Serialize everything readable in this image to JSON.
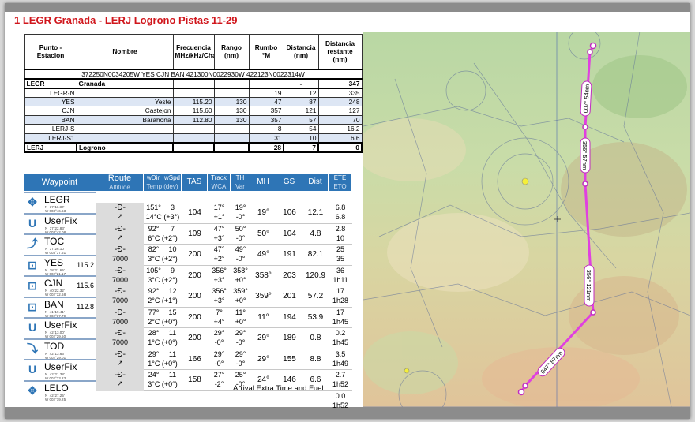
{
  "title": "1 LEGR Granada - LERJ Logrono  Pistas 11-29",
  "route_table": {
    "headers": [
      "Punto - Estacion",
      "Nombre",
      "Frecuencia MHz/kHz/Cha.",
      "Rango (nm)",
      "Rumbo °M",
      "Distancia (nm)",
      "Distancia restante (nm)"
    ],
    "code_line": "372250N0034205W  YES  CJN  BAN  421300N0022930W  422123N0022314W",
    "rows": [
      [
        "LEGR",
        "Granada",
        "",
        "",
        "",
        "-",
        "347"
      ],
      [
        "LEGR-N",
        "",
        "",
        "",
        "19",
        "12",
        "335"
      ],
      [
        "YES",
        "Yeste",
        "115.20",
        "130",
        "47",
        "87",
        "248"
      ],
      [
        "CJN",
        "Castejon",
        "115.60",
        "130",
        "357",
        "121",
        "127"
      ],
      [
        "BAN",
        "Barahona",
        "112.80",
        "130",
        "357",
        "57",
        "70"
      ],
      [
        "LERJ-S",
        "",
        "",
        "",
        "8",
        "54",
        "16.2"
      ],
      [
        "LERJ-S1",
        "",
        "",
        "",
        "31",
        "10",
        "6.6"
      ],
      [
        "LERJ",
        "Logrono",
        "",
        "",
        "28",
        "7",
        "0"
      ]
    ]
  },
  "navlog": {
    "headers": {
      "waypoint": "Waypoint",
      "route": "Route",
      "altitude": "Altitude",
      "wdir": "wDir",
      "wspd": "wSpd",
      "temp": "Temp (dev)",
      "tas": "TAS",
      "track": "Track",
      "wca": "WCA",
      "th": "TH",
      "var": "Var",
      "mh": "MH",
      "gs": "GS",
      "dist": "Dist",
      "ete": "ETE",
      "eto": "ETO"
    },
    "waypoints": [
      {
        "name": "LEGR",
        "coord": "N  37°11.32'\nW 003°46.63'",
        "freq": "",
        "icon": "airport"
      },
      {
        "name": "UserFix",
        "coord": "N  37°22.83'\nW 003°42.08'",
        "freq": "",
        "icon": "userfix"
      },
      {
        "name": "TOC",
        "coord": "N  37°26.10'\nW 003°37.61'",
        "freq": "",
        "icon": "toc"
      },
      {
        "name": "YES",
        "coord": "N  38°21.65'\nW 002°21.17'",
        "freq": "115.2",
        "icon": "vor"
      },
      {
        "name": "CJN",
        "coord": "N  40°22.32'\nW 002°32.68'",
        "freq": "115.6",
        "icon": "vor"
      },
      {
        "name": "BAN",
        "coord": "N  41°19.41'\nW 002°37.79'",
        "freq": "112.8",
        "icon": "vor"
      },
      {
        "name": "UserFix",
        "coord": "N  42°13.00'\nW 002°29.50'",
        "freq": "",
        "icon": "userfix"
      },
      {
        "name": "TOD",
        "coord": "N  42°13.66'\nW 002°29.01'",
        "freq": "",
        "icon": "tod"
      },
      {
        "name": "UserFix",
        "coord": "N  42°21.38'\nW 002°23.23'",
        "freq": "",
        "icon": "userfix"
      },
      {
        "name": "LELO",
        "coord": "N  42°27.25'\nW 002°19.25'",
        "freq": "",
        "icon": "airport"
      }
    ],
    "legs": [
      {
        "alt": "",
        "wdir": "151°",
        "wspd": "3",
        "temp": "14°C (+3°)",
        "tas": "104",
        "track": "17°",
        "wca": "+1°",
        "th": "19°",
        "var": "-0°",
        "mh": "19°",
        "gs": "106",
        "dist": "12.1",
        "ete": "6.8",
        "eto": "6.8"
      },
      {
        "alt": "",
        "wdir": "92°",
        "wspd": "7",
        "temp": "6°C (+2°)",
        "tas": "109",
        "track": "47°",
        "wca": "+3°",
        "th": "50°",
        "var": "-0°",
        "mh": "50°",
        "gs": "104",
        "dist": "4.8",
        "ete": "2.8",
        "eto": "10"
      },
      {
        "alt": "7000",
        "wdir": "82°",
        "wspd": "10",
        "temp": "3°C (+2°)",
        "tas": "200",
        "track": "47°",
        "wca": "+2°",
        "th": "49°",
        "var": "-0°",
        "mh": "49°",
        "gs": "191",
        "dist": "82.1",
        "ete": "25",
        "eto": "35"
      },
      {
        "alt": "7000",
        "wdir": "105°",
        "wspd": "9",
        "temp": "3°C (+2°)",
        "tas": "200",
        "track": "356°",
        "wca": "+3°",
        "th": "358°",
        "var": "+0°",
        "mh": "358°",
        "gs": "203",
        "dist": "120.9",
        "ete": "36",
        "eto": "1h11"
      },
      {
        "alt": "7000",
        "wdir": "92°",
        "wspd": "12",
        "temp": "2°C (+1°)",
        "tas": "200",
        "track": "356°",
        "wca": "+3°",
        "th": "359°",
        "var": "+0°",
        "mh": "359°",
        "gs": "201",
        "dist": "57.2",
        "ete": "17",
        "eto": "1h28"
      },
      {
        "alt": "7000",
        "wdir": "77°",
        "wspd": "15",
        "temp": "2°C (+0°)",
        "tas": "200",
        "track": "7°",
        "wca": "+4°",
        "th": "11°",
        "var": "+0°",
        "mh": "11°",
        "gs": "194",
        "dist": "53.9",
        "ete": "17",
        "eto": "1h45"
      },
      {
        "alt": "7000",
        "wdir": "28°",
        "wspd": "11",
        "temp": "1°C (+0°)",
        "tas": "200",
        "track": "29°",
        "wca": "-0°",
        "th": "29°",
        "var": "-0°",
        "mh": "29°",
        "gs": "189",
        "dist": "0.8",
        "ete": "0.2",
        "eto": "1h45"
      },
      {
        "alt": "",
        "wdir": "29°",
        "wspd": "11",
        "temp": "1°C (+0°)",
        "tas": "166",
        "track": "29°",
        "wca": "-0°",
        "th": "29°",
        "var": "-0°",
        "mh": "29°",
        "gs": "155",
        "dist": "8.8",
        "ete": "3.5",
        "eto": "1h49"
      },
      {
        "alt": "",
        "wdir": "24°",
        "wspd": "11",
        "temp": "3°C (+0°)",
        "tas": "158",
        "track": "27°",
        "wca": "-2°",
        "th": "25°",
        "var": "-0°",
        "mh": "24°",
        "gs": "146",
        "dist": "6.6",
        "ete": "2.7",
        "eto": "1h52"
      }
    ],
    "arrival_label": "Arrival Extra Time and Fuel",
    "arrival_ete": "0.0",
    "arrival_eto": "1h52"
  },
  "map": {
    "route_color": "#e040e0",
    "labels": [
      "007° 54nm",
      "356° 57nm",
      "356° 121nm",
      "047° 87nm"
    ]
  }
}
